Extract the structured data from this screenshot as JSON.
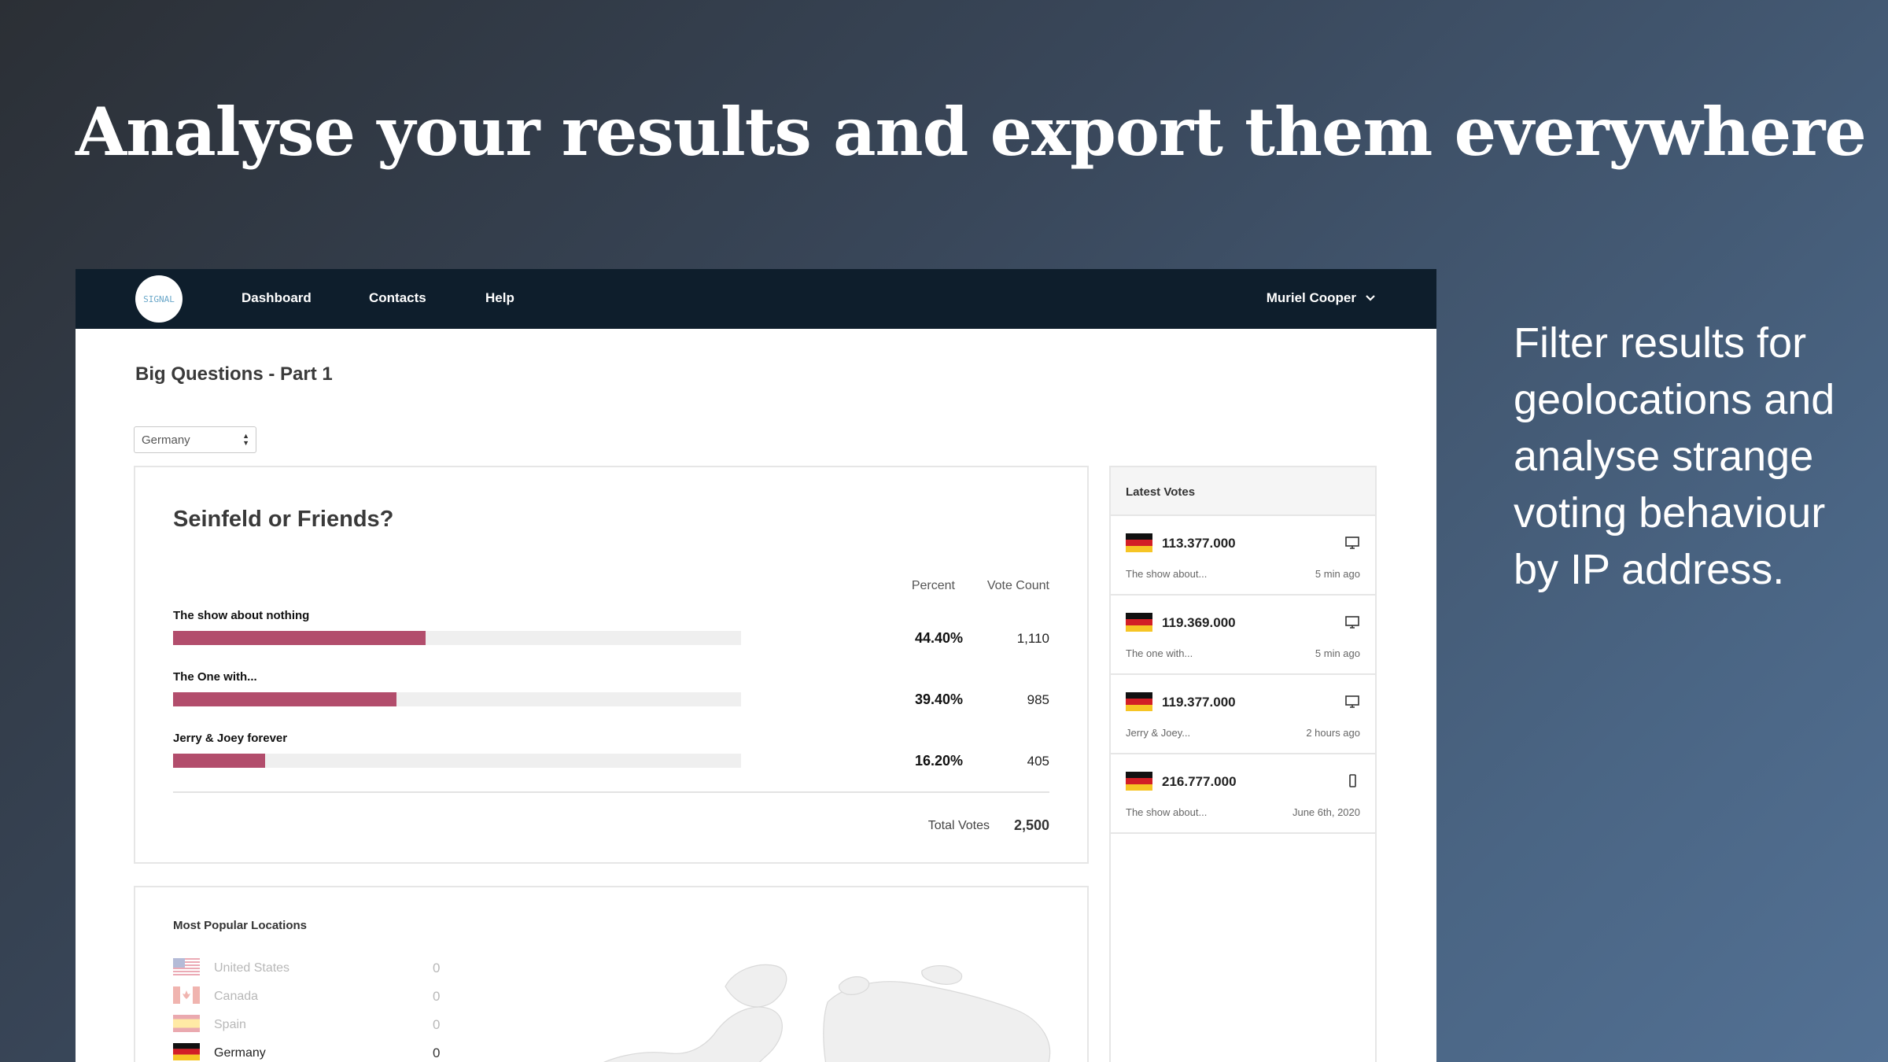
{
  "hero": {
    "title": "Analyse your results and export them everywhere",
    "side_text": "Filter results for geolocations and analyse strange voting behaviour by IP address."
  },
  "navbar": {
    "logo_text": "SIGNAL",
    "links": [
      "Dashboard",
      "Contacts",
      "Help"
    ],
    "user": "Muriel Cooper"
  },
  "page": {
    "title": "Big Questions - Part 1",
    "country_filter": "Germany"
  },
  "results": {
    "question": "Seinfeld or Friends?",
    "col_percent": "Percent",
    "col_vote_count": "Vote Count",
    "answers": [
      {
        "label": "The show about nothing",
        "percent": "44.40%",
        "count": "1,110",
        "fraction": 0.444
      },
      {
        "label": "The One with...",
        "percent": "39.40%",
        "count": "985",
        "fraction": 0.394
      },
      {
        "label": "Jerry & Joey forever",
        "percent": "16.20%",
        "count": "405",
        "fraction": 0.162
      }
    ],
    "total_label": "Total Votes",
    "total_value": "2,500",
    "bar_color": "#b24d6c"
  },
  "latest_votes": {
    "title": "Latest Votes",
    "items": [
      {
        "ip": "113.377.000",
        "answer": "The show about...",
        "time": "5 min ago",
        "device": "desktop-icon"
      },
      {
        "ip": "119.369.000",
        "answer": "The one with...",
        "time": "5 min ago",
        "device": "desktop-icon"
      },
      {
        "ip": "119.377.000",
        "answer": "Jerry & Joey...",
        "time": "2 hours ago",
        "device": "desktop-icon"
      },
      {
        "ip": "216.777.000",
        "answer": "The show about...",
        "time": "June 6th, 2020",
        "device": "mobile-icon"
      }
    ]
  },
  "locations": {
    "title": "Most Popular Locations",
    "items": [
      {
        "name": "United States",
        "count": "0"
      },
      {
        "name": "Canada",
        "count": "0"
      },
      {
        "name": "Spain",
        "count": "0"
      },
      {
        "name": "Germany",
        "count": "0"
      }
    ]
  }
}
